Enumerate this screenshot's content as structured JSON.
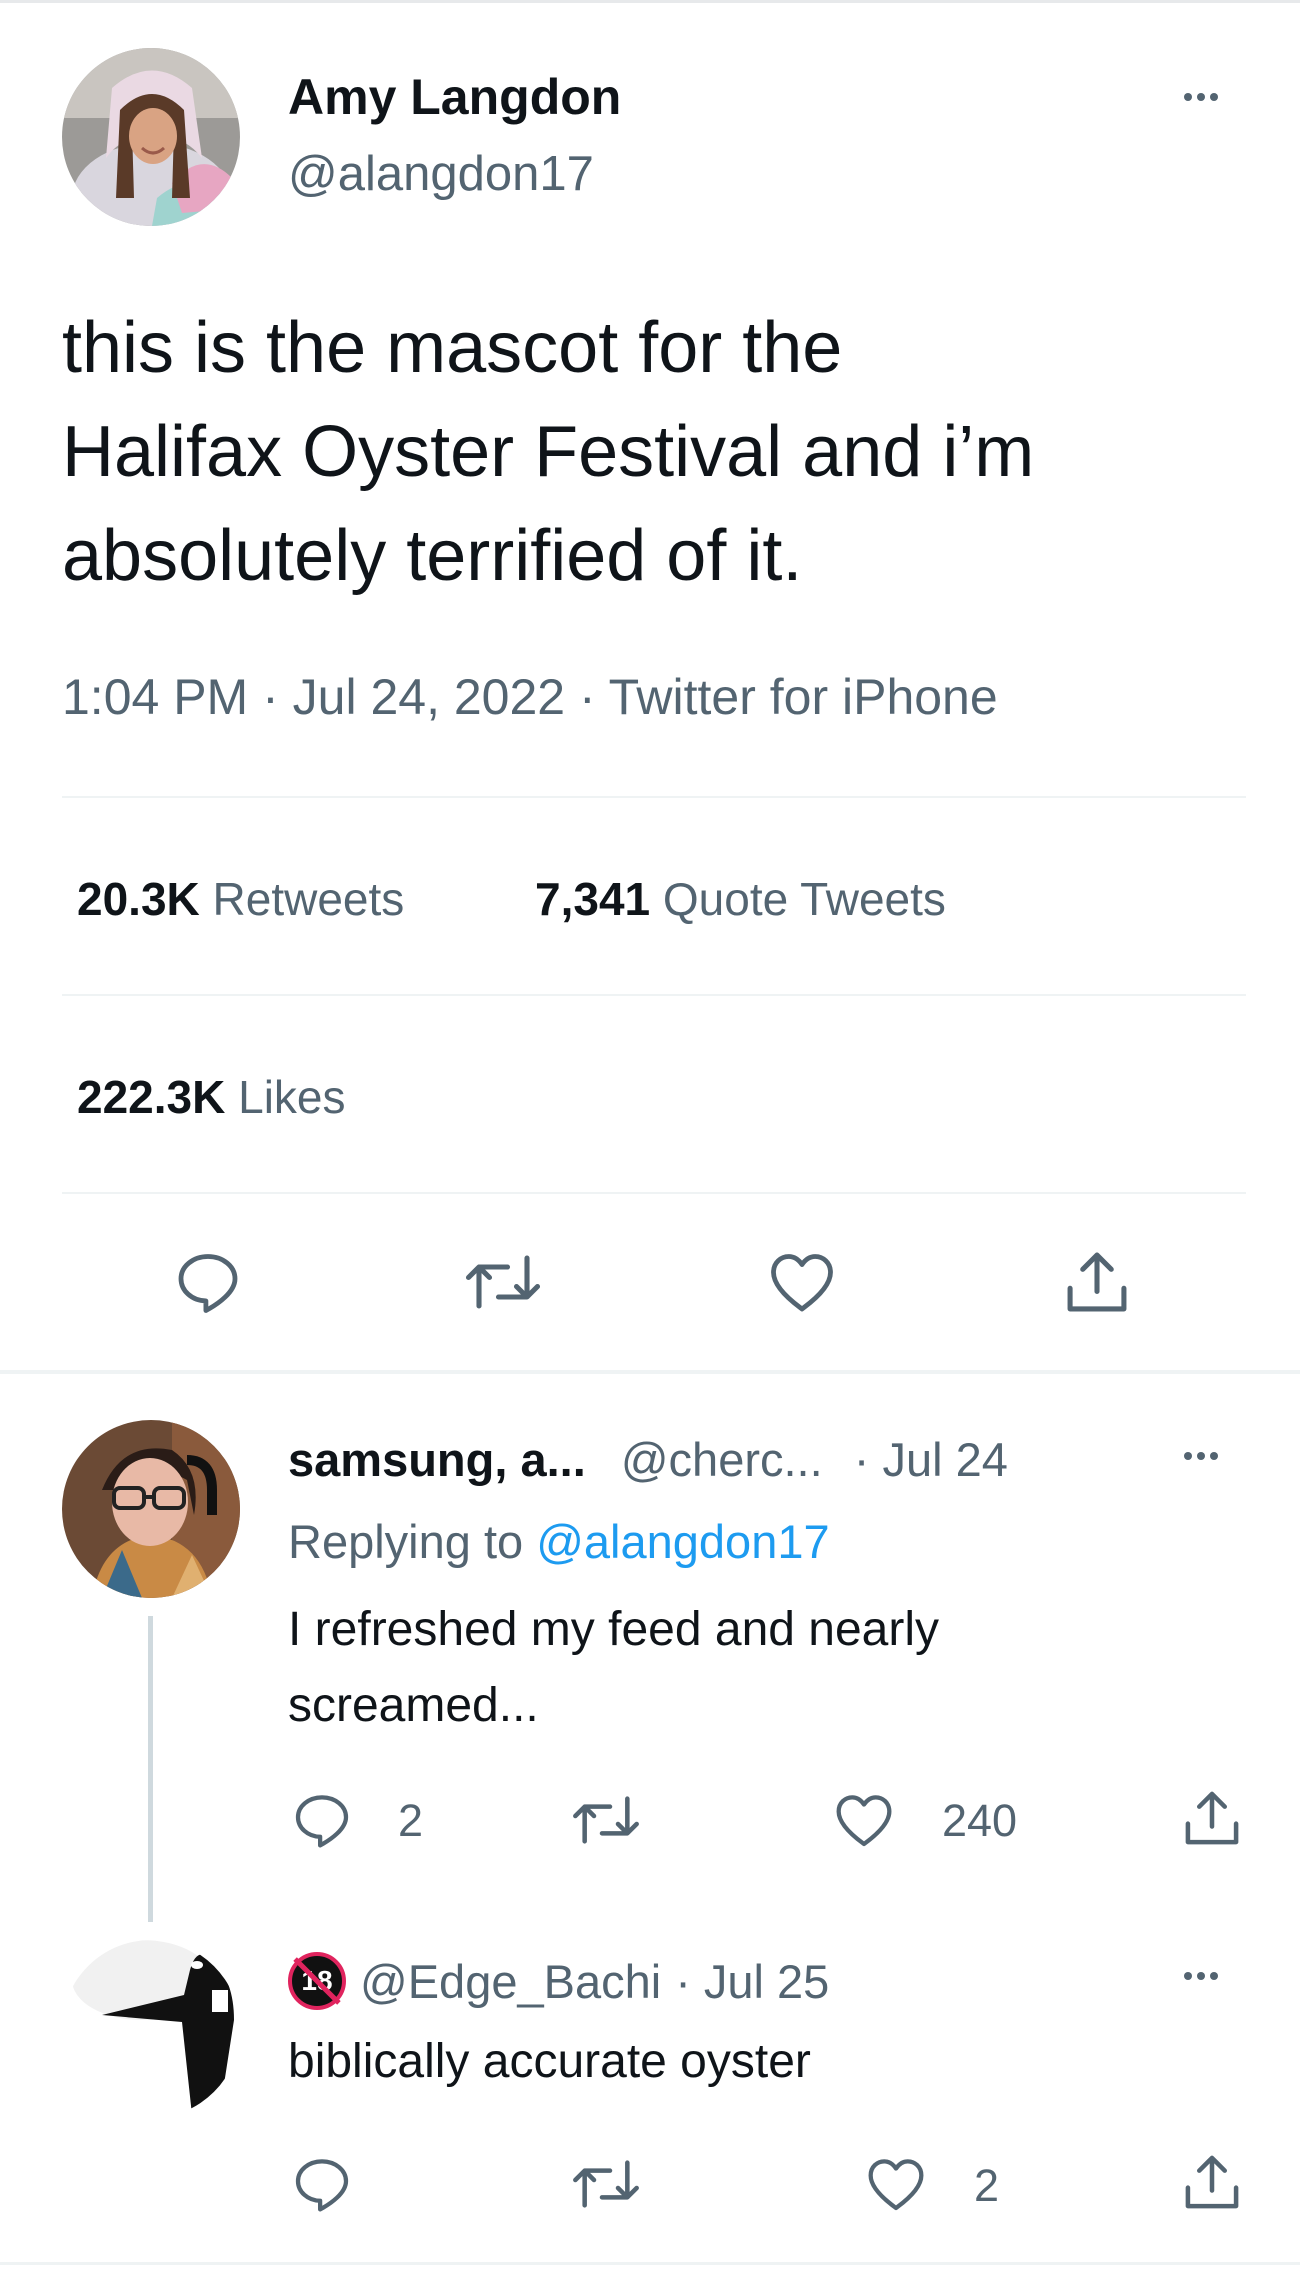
{
  "tweet": {
    "author_name": "Amy Langdon",
    "author_handle": "@alangdon17",
    "text_lines": [
      "this is the mascot for the",
      "Halifax Oyster Festival and i’m",
      "absolutely terrified of it."
    ],
    "meta": "1:04 PM · Jul 24, 2022 · Twitter for iPhone",
    "stats": {
      "retweets_count": "20.3K",
      "retweets_label": "Retweets",
      "quotes_count": "7,341",
      "quotes_label": "Quote Tweets",
      "likes_count": "222.3K",
      "likes_label": "Likes"
    },
    "action_icons": [
      "reply-icon",
      "retweet-icon",
      "like-icon",
      "share-icon"
    ]
  },
  "replies": [
    {
      "display_name": "samsung, a...",
      "handle": "@cherc...",
      "date": "· Jul 24",
      "replying_prefix": "Replying to",
      "replying_handle": "@alangdon17",
      "text_lines": [
        "I refreshed my feed and nearly",
        "screamed..."
      ],
      "reply_count": "2",
      "retweet_count": "",
      "like_count": "240"
    },
    {
      "badge": "18",
      "handle": "@Edge_Bachi",
      "date": "· Jul 25",
      "text": "biblically accurate oyster",
      "reply_count": "",
      "retweet_count": "",
      "like_count": "2"
    }
  ],
  "colors": {
    "text": "#0f1419",
    "secondary": "#536471",
    "link": "#1d9bf0",
    "divider": "#eff3f4"
  }
}
